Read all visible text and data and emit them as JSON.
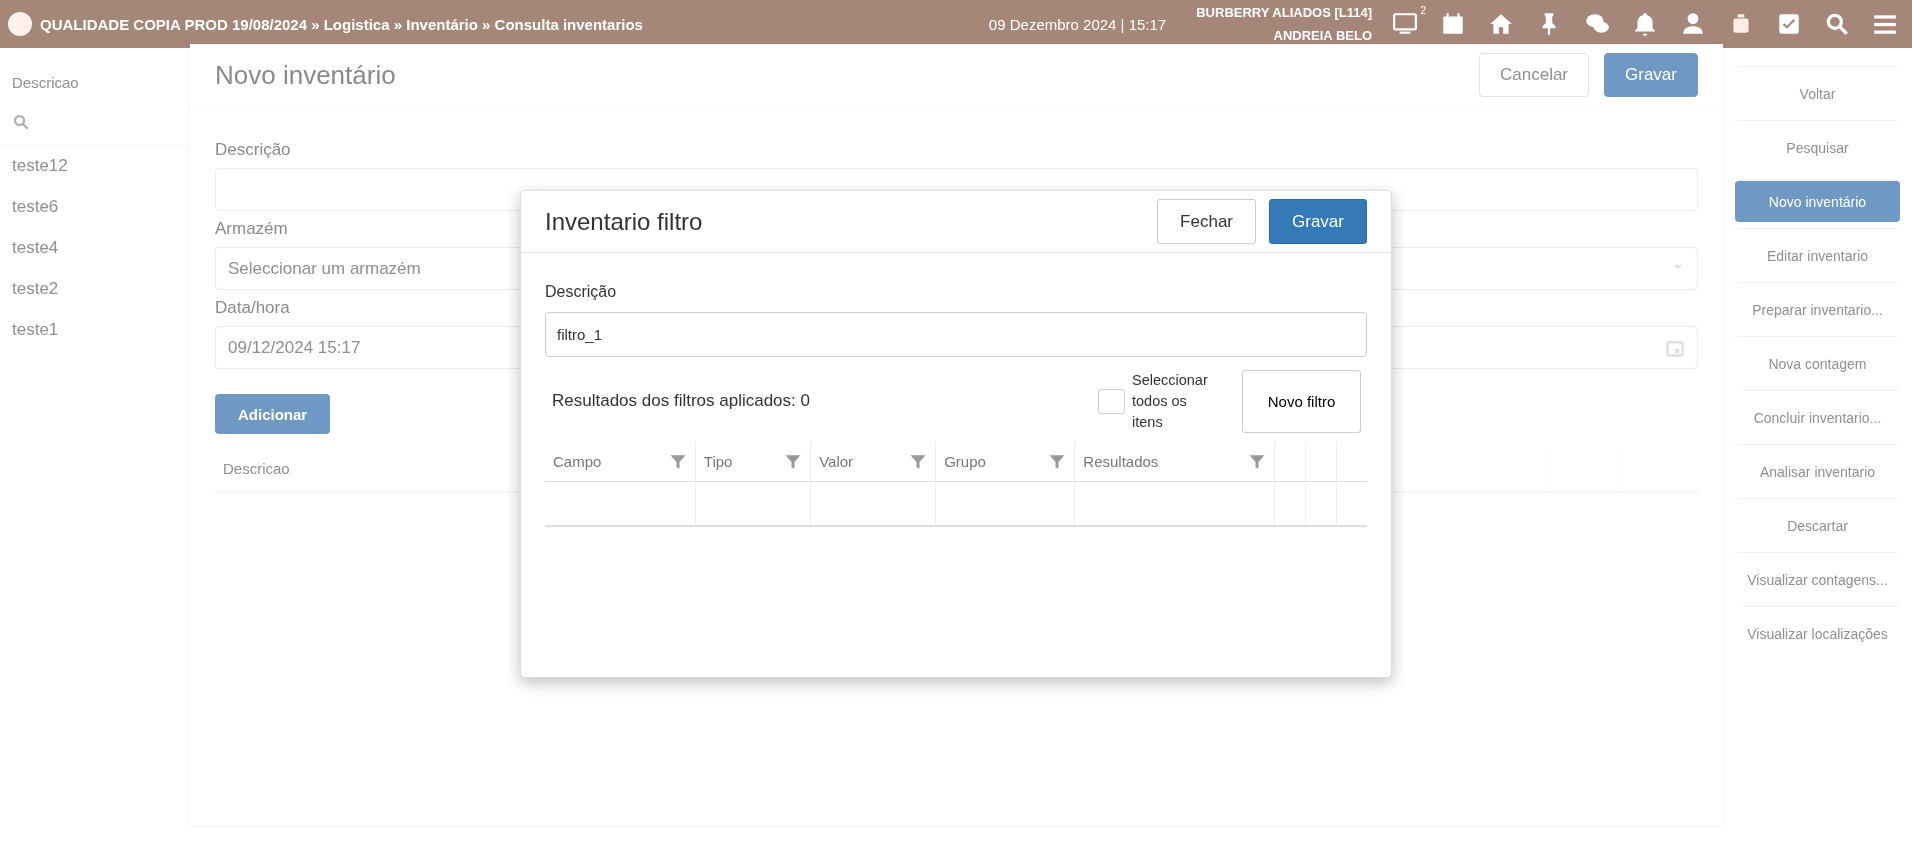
{
  "top_bar": {
    "title": "QUALIDADE COPIA PROD 19/08/2024 » Logistica » Inventário » Consulta inventarios",
    "datetime": "09 Dezembro 2024 | 15:17",
    "company": "BURBERRY ALIADOS [L114]",
    "user": "ANDREIA BELO",
    "screen_badge": "2"
  },
  "list_panel": {
    "column": "Descricao",
    "items": [
      "teste12",
      "teste6",
      "teste4",
      "teste2",
      "teste1"
    ]
  },
  "form": {
    "title": "Novo inventário",
    "buttons": [
      {
        "label": "Cancelar",
        "kind": "secondary"
      },
      {
        "label": "Gravar",
        "kind": "primary"
      }
    ],
    "fields": [
      {
        "label": "Descrição",
        "kind": "text"
      },
      {
        "label": "Armazém",
        "kind": "select",
        "placeholder": "Seleccionar um armazém"
      },
      {
        "label": "Data/hora",
        "kind": "date",
        "value": "09/12/2024 15:17"
      }
    ],
    "add_button": "Adicionar",
    "table_column": "Descricao"
  },
  "actions": [
    {
      "label": "Voltar",
      "selected": false
    },
    {
      "label": "Pesquisar",
      "selected": false
    },
    {
      "label": "Novo inventário",
      "selected": true
    },
    {
      "label": "Editar inventario",
      "selected": false
    },
    {
      "label": "Preparar inventario...",
      "selected": false
    },
    {
      "label": "Nova contagem",
      "selected": false
    },
    {
      "label": "Concluir inventario...",
      "selected": false
    },
    {
      "label": "Analisar inventario",
      "selected": false
    },
    {
      "label": "Descartar",
      "selected": false
    },
    {
      "label": "Visualizar contagens...",
      "selected": false
    },
    {
      "label": "Visualizar localizações",
      "selected": false
    }
  ],
  "modal": {
    "title": "Inventario filtro",
    "buttons": [
      {
        "label": "Fechar",
        "kind": "secondary"
      },
      {
        "label": "Gravar",
        "kind": "primary"
      }
    ],
    "description_label": "Descrição",
    "description_value": "filtro_1",
    "results_text": "Resultados dos filtros aplicados: 0",
    "select_all": {
      "label": "Seleccionar todos os itens",
      "checked": false
    },
    "new_filter_button": "Novo filtro",
    "columns": [
      "Campo",
      "Tipo",
      "Valor",
      "Grupo",
      "Resultados"
    ]
  }
}
